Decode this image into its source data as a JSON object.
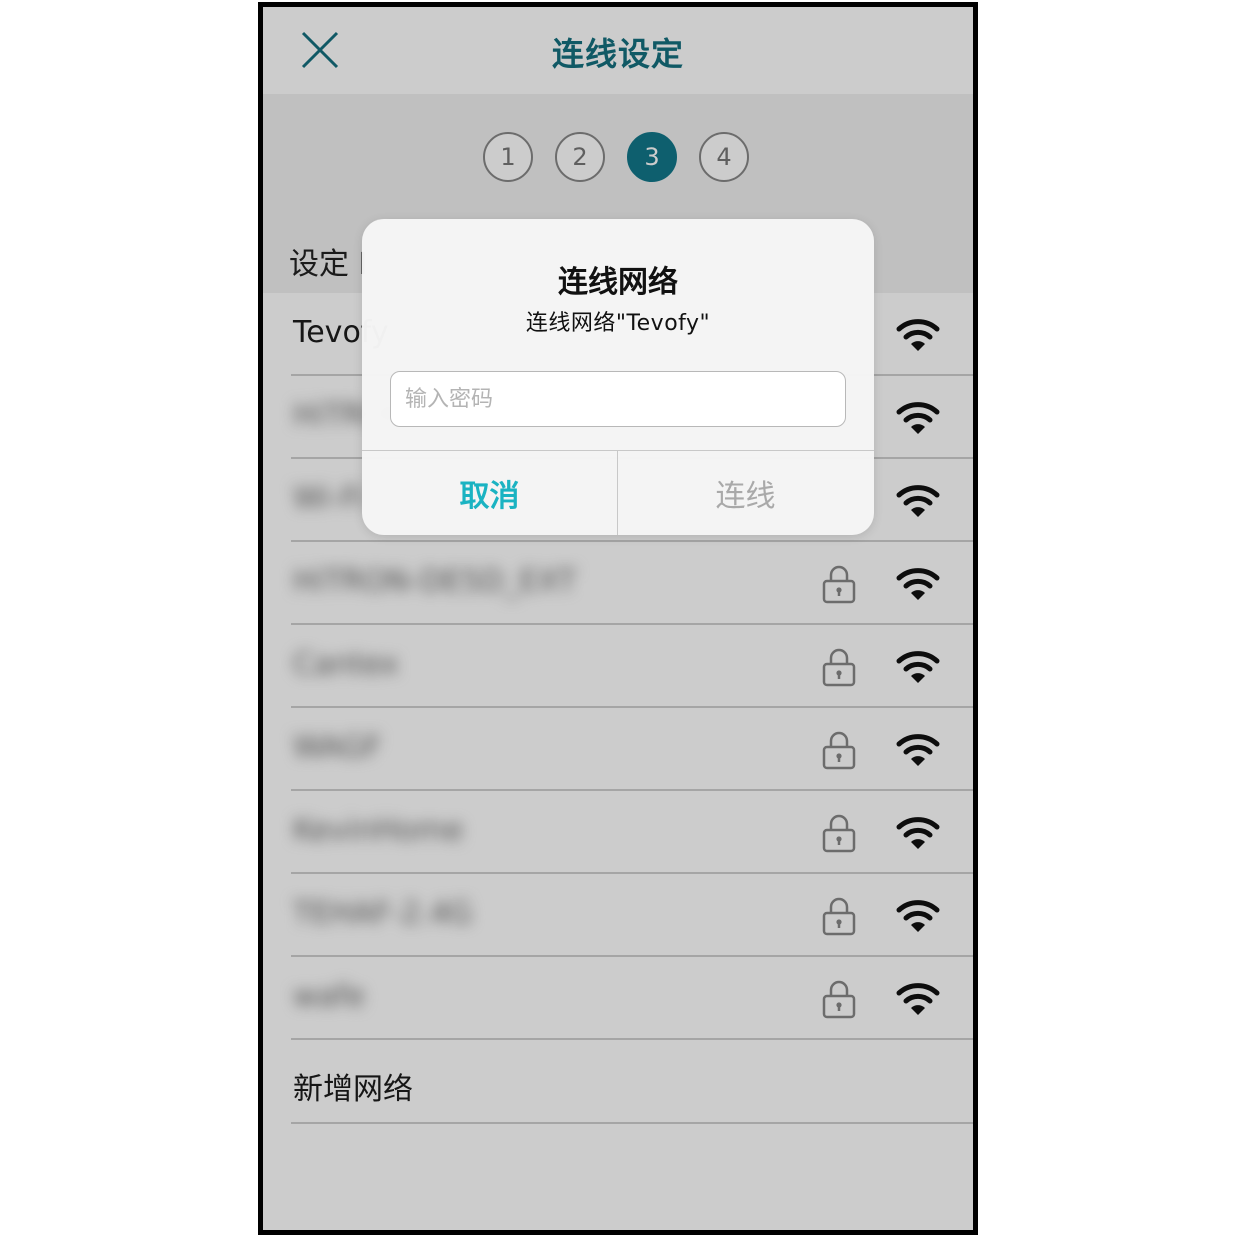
{
  "header": {
    "title": "连线设定",
    "close_icon": "close-icon"
  },
  "steps": [
    {
      "label": "1",
      "active": false
    },
    {
      "label": "2",
      "active": false
    },
    {
      "label": "3",
      "active": true
    },
    {
      "label": "4",
      "active": false
    }
  ],
  "section_label": "设定 I",
  "networks": [
    {
      "name": "Tevofy",
      "locked": false,
      "blurred": false
    },
    {
      "name": "HiTRON",
      "locked": false,
      "blurred": true
    },
    {
      "name": "Wi-Fi",
      "locked": false,
      "blurred": true
    },
    {
      "name": "HiTRON-DE5D_EXT",
      "locked": true,
      "blurred": true
    },
    {
      "name": "Cantex",
      "locked": true,
      "blurred": true
    },
    {
      "name": "WAGF",
      "locked": true,
      "blurred": true
    },
    {
      "name": "KevinHome",
      "locked": true,
      "blurred": true
    },
    {
      "name": "TEHAF-2.4G",
      "locked": true,
      "blurred": true
    },
    {
      "name": "wafe",
      "locked": true,
      "blurred": true
    }
  ],
  "add_network_label": "新增网络",
  "dialog": {
    "title": "连线网络",
    "message": "连线网络\"Tevofy\"",
    "password_placeholder": "输入密码",
    "password_value": "",
    "cancel_label": "取消",
    "connect_label": "连线"
  },
  "colors": {
    "accent": "#15707f",
    "active_step": "#12778a",
    "cancel_text": "#1ab3c2",
    "disabled_text": "#a9a9a9"
  }
}
